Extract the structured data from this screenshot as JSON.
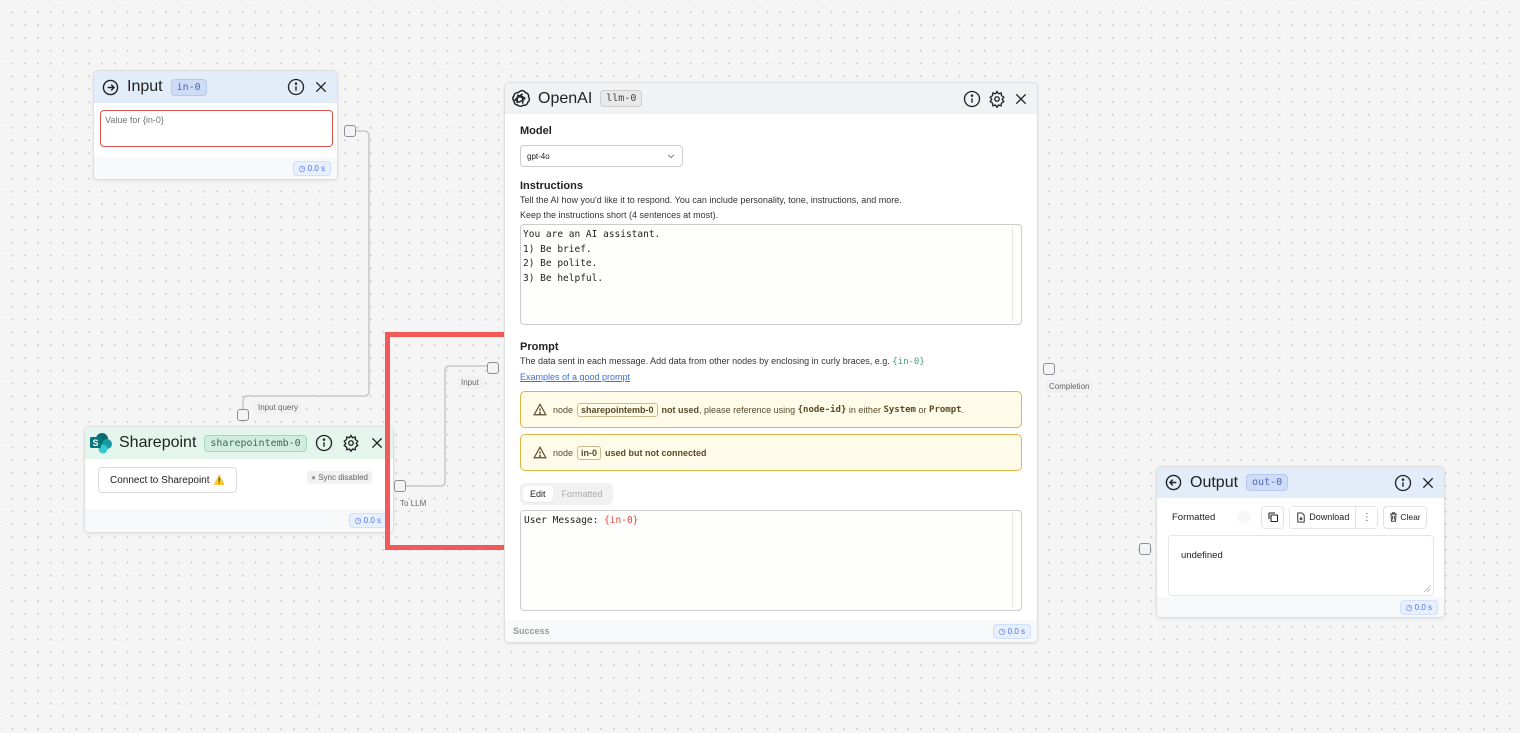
{
  "canvas": {
    "highlight_color": "#f25a5a",
    "background_color": "#f5f5f5"
  },
  "input_node": {
    "title": "Input",
    "badge": "in-0",
    "placeholder": "Value for {in-0}",
    "value": "",
    "time": "0.0 s",
    "icons": [
      "arrow-right-circle-icon",
      "info-icon",
      "close-icon"
    ]
  },
  "sharepoint_node": {
    "title": "Sharepoint",
    "badge": "sharepointemb-0",
    "connect_label": "Connect to Sharepoint",
    "warning_glyph": "⚠️",
    "sync_status": "Sync disabled",
    "time": "0.0 s",
    "input_handle_label": "Input query",
    "output_handle_label": "To LLM",
    "icons": [
      "sharepoint-logo-icon",
      "info-icon",
      "gear-icon",
      "close-icon"
    ]
  },
  "openai_node": {
    "title": "OpenAI",
    "badge": "llm-0",
    "model_label": "Model",
    "model_value": "gpt-4o",
    "instructions_label": "Instructions",
    "instructions_desc_1": "Tell the AI how you'd like it to respond. You can include personality, tone, instructions, and more.",
    "instructions_desc_2": "Keep the instructions short (4 sentences at most).",
    "instructions_value": "You are an AI assistant.\n1) Be brief.\n2) Be polite.\n3) Be helpful.",
    "prompt_label": "Prompt",
    "prompt_desc": "The data sent in each message. Add data from other nodes by enclosing in curly braces, e.g.",
    "prompt_desc_example": "{in-0}",
    "prompt_link": "Examples of a good prompt",
    "warnings": [
      {
        "prefix": "node",
        "node_id": "sharepointemb-0",
        "bold": "not used",
        "text_1": ", please reference using",
        "code_1": "{node-id}",
        "text_2": "in either",
        "code_2": "System",
        "text_3": "or",
        "code_3": "Prompt",
        "text_4": "."
      },
      {
        "prefix": "node",
        "node_id": "in-0",
        "bold": "used but not connected"
      }
    ],
    "tabs": [
      {
        "label": "Edit",
        "active": true
      },
      {
        "label": "Formatted",
        "active": false
      }
    ],
    "prompt_value_prefix": "User Message: ",
    "prompt_value_var": "{in-0}",
    "input_handle_label": "Input",
    "output_handle_label": "Completion",
    "status": "Success",
    "time": "0.0 s",
    "icons": [
      "openai-logo-icon",
      "info-icon",
      "gear-icon",
      "close-icon"
    ]
  },
  "output_node": {
    "title": "Output",
    "badge": "out-0",
    "formatted_label": "Formatted",
    "download_label": "Download",
    "clear_label": "Clear",
    "output_value": "undefined",
    "time": "0.0 s",
    "icons": [
      "arrow-left-circle-icon",
      "info-icon",
      "close-icon",
      "copy-icon",
      "download-file-icon",
      "more-vertical-icon",
      "trash-icon"
    ]
  }
}
